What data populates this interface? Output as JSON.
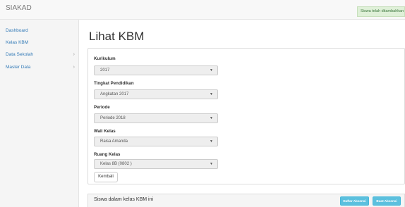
{
  "app": {
    "brand": "SIAKAD"
  },
  "toast": {
    "message": "Siswa telah ditambahkan"
  },
  "sidebar": {
    "items": [
      {
        "label": "Dashboard",
        "has_submenu": false
      },
      {
        "label": "Kelas KBM",
        "has_submenu": false
      },
      {
        "label": "Data Sekolah",
        "has_submenu": true
      },
      {
        "label": "Master Data",
        "has_submenu": true
      }
    ]
  },
  "page": {
    "title": "Lihat KBM"
  },
  "form": {
    "kurikulum": {
      "label": "Kurikulum",
      "value": "2017"
    },
    "tingkat": {
      "label": "Tingkat Pendidikan",
      "value": "Angkatan 2017"
    },
    "periode": {
      "label": "Periode",
      "value": "Periode 2018"
    },
    "wali": {
      "label": "Wali Kelas",
      "value": "Raisa Amanda"
    },
    "ruang": {
      "label": "Ruang Kelas",
      "value": "Kelas 8B (0802 )"
    },
    "back_label": "Kembali"
  },
  "students_panel": {
    "title": "Siswa dalam kelas KBM ini",
    "daftar_absensi_label": "Daftar Absensi",
    "buat_absensi_label": "Buat Absensi"
  },
  "colors": {
    "link": "#337ab7",
    "info": "#5bc0de",
    "success_bg": "#dff0d8"
  }
}
